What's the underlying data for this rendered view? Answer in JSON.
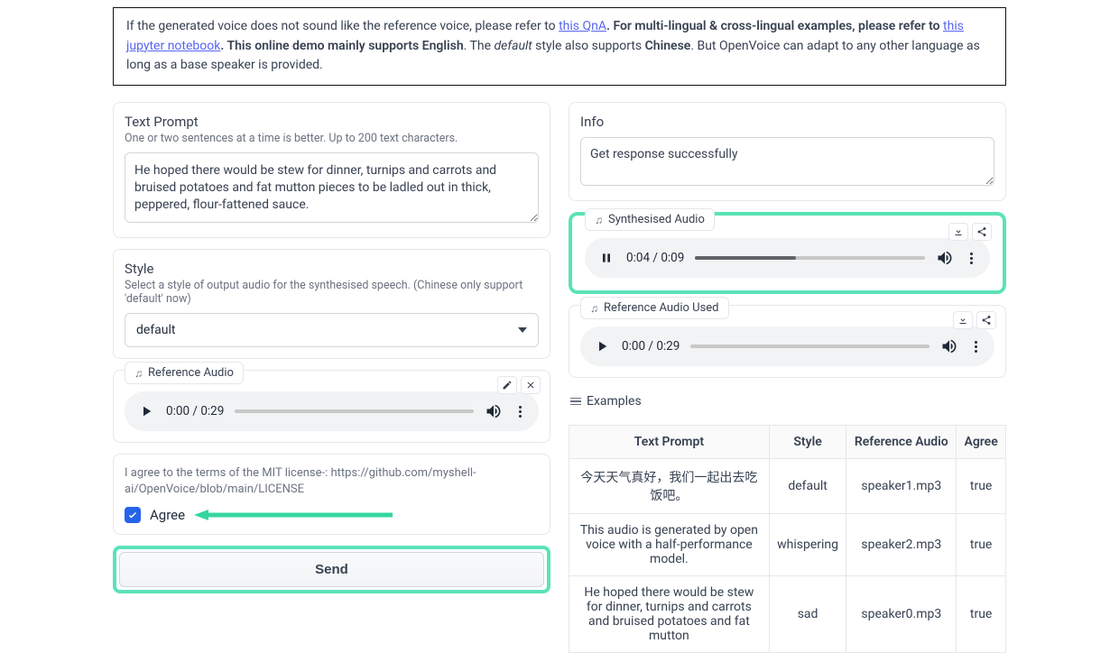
{
  "notice": {
    "pre_link": "If the generated voice does not sound like the reference voice, please refer to ",
    "qna_link": "this QnA",
    "mid1": ". For multi-lingual & cross-lingual examples, please refer to ",
    "notebook_link": "this jupyter notebook",
    "mid2": ". This online demo mainly supports ",
    "english": "English",
    "mid3": ". The ",
    "default_style": "default",
    "mid4": " style also supports ",
    "chinese": "Chinese",
    "tail": ". But OpenVoice can adapt to any other language as long as a base speaker is provided."
  },
  "left": {
    "prompt_title": "Text Prompt",
    "prompt_help": "One or two sentences at a time is better. Up to 200 text characters.",
    "prompt_value": "He hoped there would be stew for dinner, turnips and carrots and bruised potatoes and fat mutton pieces to be ladled out in thick, peppered, flour-fattened sauce.",
    "style_title": "Style",
    "style_help": "Select a style of output audio for the synthesised speech. (Chinese only support 'default' now)",
    "style_value": "default",
    "ref_title": "Reference Audio",
    "ref_time_cur": "0:00",
    "ref_time_total": "0:29",
    "agree_help": "I agree to the terms of the MIT license-: https://github.com/myshell-ai/OpenVoice/blob/main/LICENSE",
    "agree_label": "Agree",
    "send_label": "Send"
  },
  "right": {
    "info_title": "Info",
    "info_value": "Get response successfully",
    "syn_title": "Synthesised Audio",
    "syn_time_cur": "0:04",
    "syn_time_total": "0:09",
    "used_title": "Reference Audio Used",
    "used_time_cur": "0:00",
    "used_time_total": "0:29",
    "examples_label": "Examples",
    "table": {
      "h1": "Text Prompt",
      "h2": "Style",
      "h3": "Reference Audio",
      "h4": "Agree",
      "rows": [
        {
          "tp": "今天天气真好，我们一起出去吃饭吧。",
          "style": "default",
          "ref": "speaker1.mp3",
          "agree": "true"
        },
        {
          "tp": "This audio is generated by open voice with a half-performance model.",
          "style": "whispering",
          "ref": "speaker2.mp3",
          "agree": "true"
        },
        {
          "tp": "He hoped there would be stew for dinner, turnips and carrots and bruised potatoes and fat mutton",
          "style": "sad",
          "ref": "speaker0.mp3",
          "agree": "true"
        }
      ]
    }
  }
}
